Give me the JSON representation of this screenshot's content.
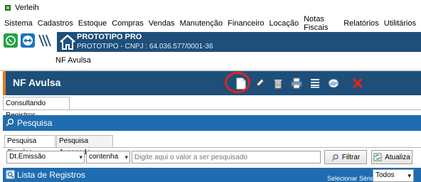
{
  "window": {
    "title": "Verleih"
  },
  "menu": {
    "items": [
      "Sistema",
      "Cadastros",
      "Estoque",
      "Compras",
      "Vendas",
      "Manutenção",
      "Financeiro",
      "Locação",
      "Notas Fiscais",
      "Relatórios",
      "Utilitários"
    ]
  },
  "brand": {
    "name": "PROTOTIPO PRO",
    "subtitle": "PROTOTIPO - CNPJ : 64.036.577/0001-36",
    "color": "#1d4f7a"
  },
  "quick_icons": [
    "whatsapp-icon",
    "teamviewer-icon",
    "vendor-logo-icon"
  ],
  "tabs": {
    "active": "NF Avulsa"
  },
  "form": {
    "title": "NF Avulsa",
    "accent": "#e07b1f",
    "toolbar": [
      "new-document-icon",
      "edit-pencil-icon",
      "trash-icon",
      "print-icon",
      "list-icon",
      "refresh-icon",
      "close-x-icon"
    ],
    "highlight_color": "#e2231a"
  },
  "subtab": {
    "label": "Consultando Registros"
  },
  "pesquisa": {
    "title": "Pesquisa",
    "color": "#1f6db0"
  },
  "inner_tabs": {
    "simple": "Pesquisa Simples",
    "advanced": "Pesquisa Avançada"
  },
  "filter": {
    "field": "Dt.Emissão",
    "operator": "contenha",
    "placeholder": "Digite aqui o valor a ser pesquisado",
    "filter_button": "Filtrar",
    "refresh_button": "Atualiza"
  },
  "list": {
    "title": "Lista de Registros",
    "serie_label": "Selecionar Série :",
    "serie_value": "Todos"
  }
}
